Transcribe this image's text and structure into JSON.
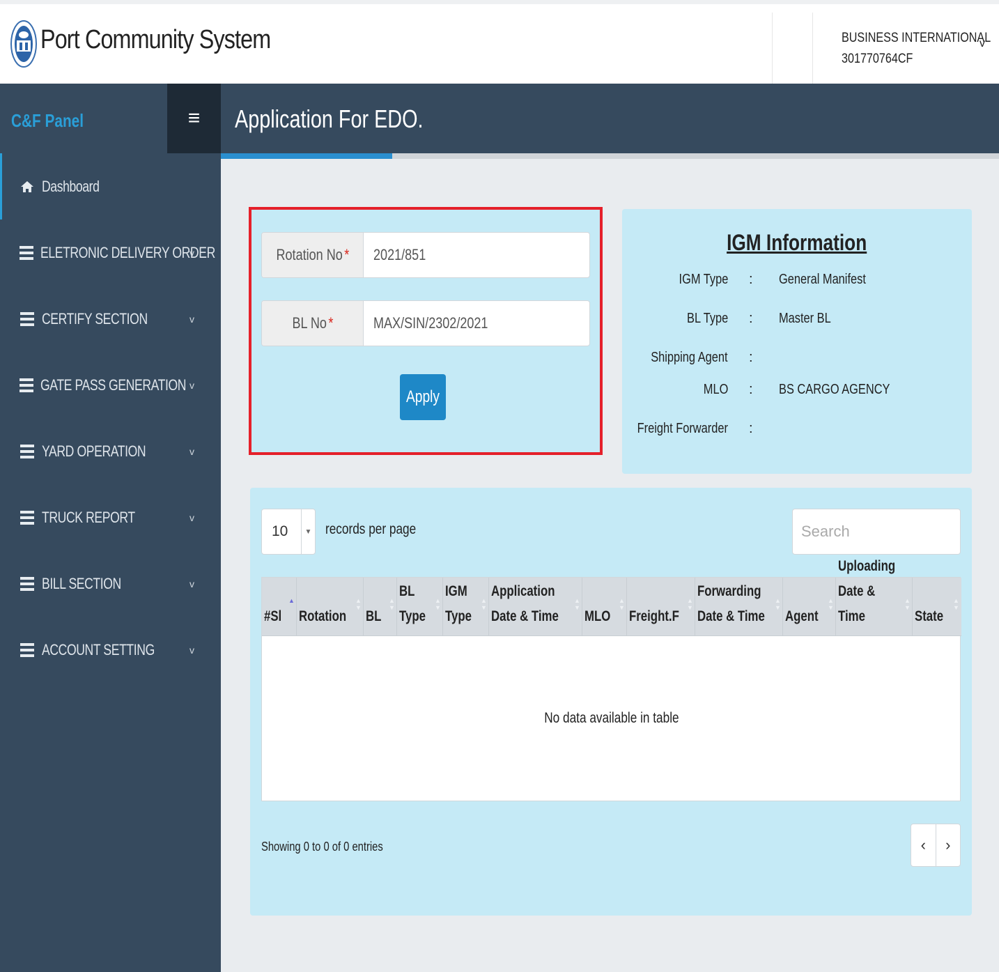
{
  "header": {
    "app_title": "Port Community System",
    "user_name": "BUSINESS INTERNATIONAL",
    "user_id": "301770764CF",
    "user_caret": "v"
  },
  "sidebar": {
    "brand": "C&F Panel",
    "menu_toggle": "≡",
    "items": [
      {
        "label": "Dashboard",
        "icon": "home-icon"
      },
      {
        "label": "ELETRONIC DELIVERY ORDER",
        "icon": "list-icon"
      },
      {
        "label": "CERTIFY SECTION",
        "icon": "list-icon"
      },
      {
        "label": "GATE PASS GENERATION",
        "icon": "list-icon"
      },
      {
        "label": "YARD OPERATION",
        "icon": "list-icon"
      },
      {
        "label": "TRUCK REPORT",
        "icon": "list-icon"
      },
      {
        "label": "BILL SECTION",
        "icon": "list-icon"
      },
      {
        "label": "ACCOUNT SETTING",
        "icon": "list-icon"
      }
    ],
    "chevron": "v"
  },
  "page": {
    "title": "Application For EDO."
  },
  "form": {
    "rotation_label": "Rotation No",
    "rotation_value": "2021/851",
    "bl_label": "BL No",
    "bl_value": "MAX/SIN/2302/2021",
    "required_mark": "*",
    "apply_label": "Apply"
  },
  "igm": {
    "title": "IGM Information",
    "separator": ":",
    "rows": [
      {
        "key": "IGM Type",
        "value": "General Manifest"
      },
      {
        "key": "BL Type",
        "value": "Master BL"
      },
      {
        "key": "Shipping Agent",
        "value": ""
      },
      {
        "key": "MLO",
        "value": "BS CARGO AGENCY"
      },
      {
        "key": "Freight Forwarder",
        "value": ""
      }
    ]
  },
  "table": {
    "page_length": "10",
    "page_length_text": "records per page",
    "search_placeholder": "Search",
    "columns": [
      "#Sl",
      "Rotation",
      "BL",
      "BL\nType",
      "IGM\nType",
      "Application\nDate & Time",
      "MLO",
      "Freight.F",
      "Forwarding\nDate & Time",
      "Agent",
      "Uploading\nDate & Time",
      "State"
    ],
    "empty_message": "No data available in table",
    "info": "Showing 0 to 0 of 0 entries",
    "prev": "‹",
    "next": "›"
  },
  "colors": {
    "sidebar_bg": "#364a5e",
    "accent": "#2a9fd8",
    "panel_bg": "#c5eaf6",
    "highlight_border": "#e5202a",
    "button_bg": "#1e88c7"
  }
}
